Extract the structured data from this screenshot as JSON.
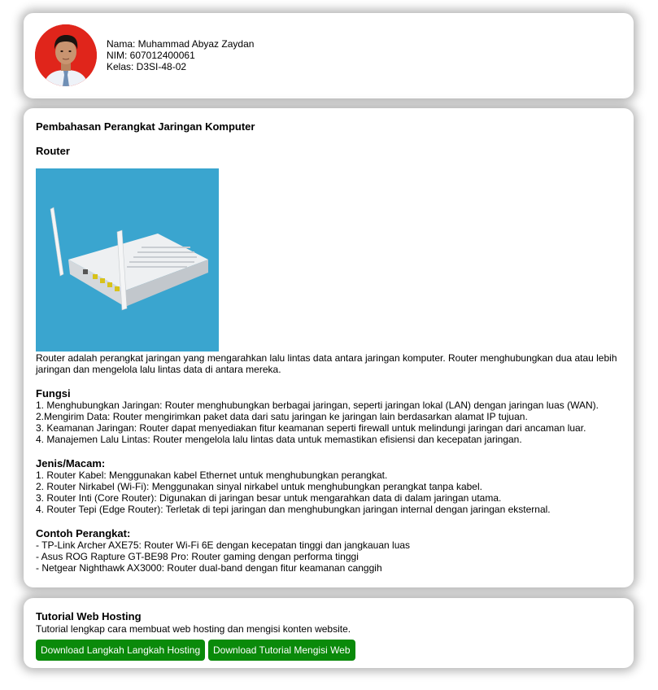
{
  "profile": {
    "name_line": "Nama: Muhammad Abyaz Zaydan",
    "nim_line": "NIM: 607012400061",
    "kelas_line": "Kelas: D3SI-48-02"
  },
  "main": {
    "page_title": "Pembahasan Perangkat Jaringan Komputer",
    "item_title": "Router",
    "description": "Router adalah perangkat jaringan yang mengarahkan lalu lintas data antara jaringan komputer. Router menghubungkan dua atau lebih jaringan dan mengelola lalu lintas data di antara mereka.",
    "sections": [
      {
        "title": "Fungsi",
        "lines": [
          "1. Menghubungkan Jaringan: Router menghubungkan berbagai jaringan, seperti jaringan lokal (LAN) dengan jaringan luas (WAN).",
          "2.Mengirim Data: Router mengirimkan paket data dari satu jaringan ke jaringan lain berdasarkan alamat IP tujuan.",
          "3. Keamanan Jaringan: Router dapat menyediakan fitur keamanan seperti firewall untuk melindungi jaringan dari ancaman luar.",
          "4. Manajemen Lalu Lintas: Router mengelola lalu lintas data untuk memastikan efisiensi dan kecepatan jaringan."
        ]
      },
      {
        "title": "Jenis/Macam:",
        "lines": [
          "1. Router Kabel: Menggunakan kabel Ethernet untuk menghubungkan perangkat.",
          "2. Router Nirkabel (Wi-Fi): Menggunakan sinyal nirkabel untuk menghubungkan perangkat tanpa kabel.",
          "3. Router Inti (Core Router): Digunakan di jaringan besar untuk mengarahkan data di dalam jaringan utama.",
          "4. Router Tepi (Edge Router): Terletak di tepi jaringan dan menghubungkan jaringan internal dengan jaringan eksternal."
        ]
      },
      {
        "title": "Contoh Perangkat:",
        "lines": [
          "- TP-Link Archer AXE75: Router Wi-Fi 6E dengan kecepatan tinggi dan jangkauan luas",
          "- Asus ROG Rapture GT-BE98 Pro: Router gaming dengan performa tinggi",
          "- Netgear Nighthawk AX3000: Router dual-band dengan fitur keamanan canggih"
        ]
      }
    ]
  },
  "hosting": {
    "title": "Tutorial Web Hosting",
    "description": "Tutorial lengkap cara membuat web hosting dan mengisi konten website.",
    "button_1": "Download Langkah Langkah Hosting",
    "button_2": "Download Tutorial Mengisi Web"
  },
  "colors": {
    "button_bg": "#0a8a0a",
    "avatar_bg": "#e0251b",
    "image_bg": "#3aa5cf"
  }
}
